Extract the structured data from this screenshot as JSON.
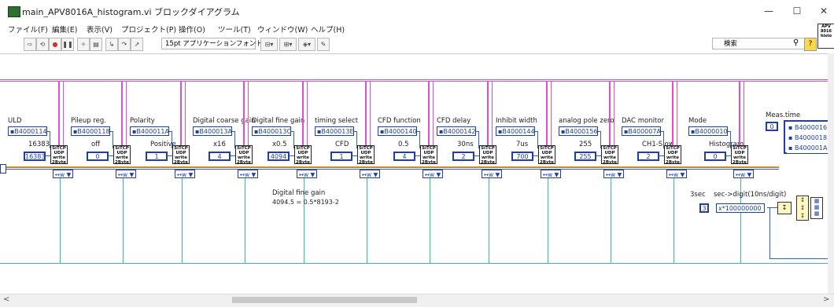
{
  "window": {
    "title": "main_APV8016A_histogram.vi ブロックダイアグラム",
    "minimize": "—",
    "maximize": "☐",
    "close": "✕"
  },
  "menu": [
    "ファイル(F)",
    "編集(E)",
    "表示(V)",
    "プロジェクト(P)",
    "操作(O)",
    "ツール(T)",
    "ウィンドウ(W)",
    "ヘルプ(H)"
  ],
  "toolbar": {
    "font": "15pt アプリケーションフォント",
    "font_arrow": "▼",
    "search_placeholder": "検索",
    "help": "?",
    "vi_icon": "APV 8016 histo"
  },
  "diagram": {
    "sections": [
      {
        "label": "ULD",
        "address": "B4000114",
        "value_text": "16383",
        "value": "16383"
      },
      {
        "label": "Pileup reg.",
        "address": "B4000118",
        "value_text": "off",
        "value": "0"
      },
      {
        "label": "Polarity",
        "address": "B400011A",
        "value_text": "Positive",
        "value": "1"
      },
      {
        "label": "Digital coarse gain",
        "address": "B400013A",
        "value_text": "x16",
        "value": "4"
      },
      {
        "label": "Digital fine gain",
        "address": "B400013C",
        "value_text": "x0.5",
        "value": "4094"
      },
      {
        "label": "timing select",
        "address": "B400013E",
        "value_text": "CFD",
        "value": "1"
      },
      {
        "label": "CFD function",
        "address": "B4000140",
        "value_text": "0.5",
        "value": "4"
      },
      {
        "label": "CFD delay",
        "address": "B4000142",
        "value_text": "30ns",
        "value": "2"
      },
      {
        "label": "Inhibit width",
        "address": "B4000144",
        "value_text": "7us",
        "value": "700"
      },
      {
        "label": "analog pole zero",
        "address": "B4000156",
        "value_text": "255",
        "value": "255"
      },
      {
        "label": "DAC monitor",
        "address": "B400007A",
        "value_text": "CH1-Slow",
        "value": "2"
      },
      {
        "label": "Mode",
        "address": "B4000010",
        "value_text": "Histogram",
        "value": "0"
      }
    ],
    "subvi_text": "SiTCP UDP write 2Byte",
    "ring_text": "↔w ▼",
    "meas_time": {
      "label": "Meas.time",
      "index": "0",
      "addresses": [
        "B4000016",
        "B4000018",
        "B400001A"
      ]
    },
    "comment_lines": [
      "Digital fine gain",
      "4094.5 = 0.5*8193-2"
    ],
    "sec_label": "3sec",
    "sec_digit_label": "sec->digit(10ns/digit)",
    "sec_value": "3",
    "multiplier": "x*100000000"
  },
  "colors": {
    "wire_pink": "#e04fd0",
    "wire_teal": "#3fb6b6",
    "wire_blue": "#2a5fd0",
    "const_blue": "#1e3fa8",
    "wire_orange": "#d08a20"
  }
}
